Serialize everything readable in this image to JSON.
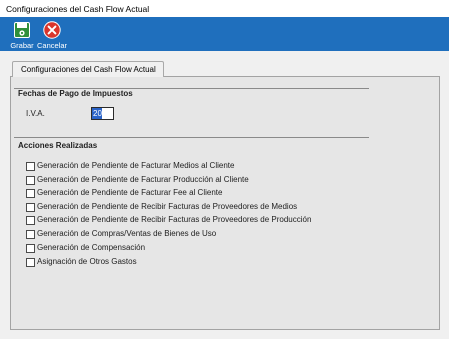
{
  "window": {
    "title": "Configuraciones del Cash Flow Actual"
  },
  "toolbar": {
    "save_label": "Grabar",
    "save_icon": "save-icon",
    "cancel_label": "Cancelar",
    "cancel_icon": "cancel-icon",
    "background": "#1f6fbd"
  },
  "tab": {
    "label": "Configuraciones del Cash Flow Actual"
  },
  "payments": {
    "title": "Fechas de Pago de Impuestos",
    "iva_label": "I.V.A.",
    "iva_value": "20"
  },
  "actions": {
    "title": "Acciones Realizadas",
    "items": [
      "Generación de Pendiente de Facturar Medios al Cliente",
      "Generación de Pendiente de Facturar Producción al Cliente",
      "Generación de Pendiente de Facturar Fee al Cliente",
      "Generación de Pendiente de Recibir Facturas de Proveedores de Medios",
      "Generación de Pendiente de Recibir Facturas de Proveedores de Producción",
      "Generación de Compras/Ventas de Bienes de Uso",
      "Generación de Compensación",
      "Asignación de Otros Gastos"
    ]
  }
}
